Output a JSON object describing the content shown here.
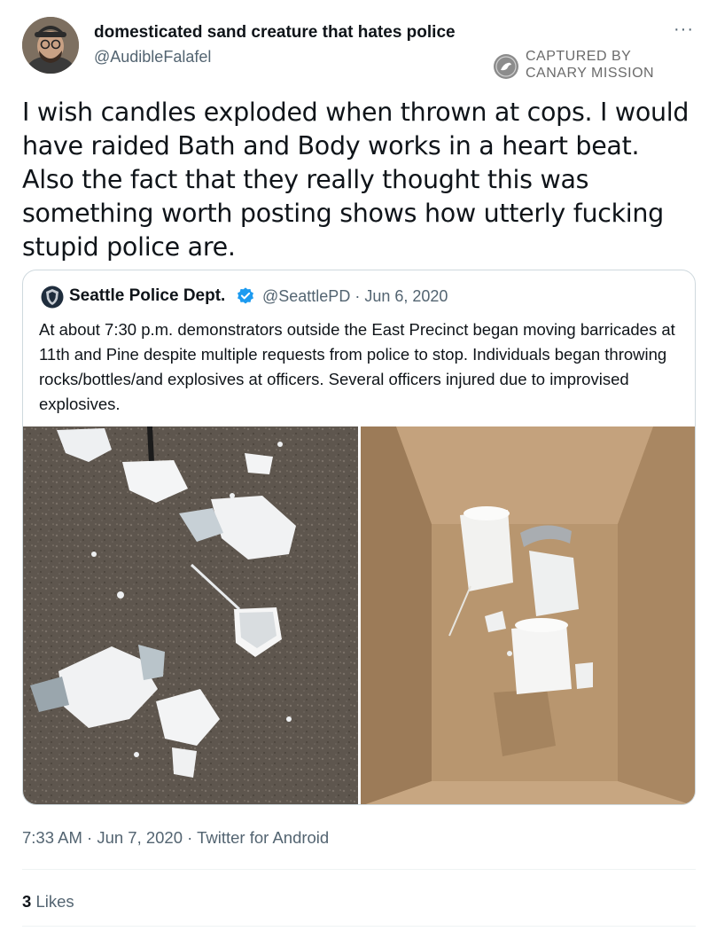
{
  "tweet": {
    "author_name": "domesticated sand creature that hates police",
    "author_handle": "@AudibleFalafel",
    "more_label": "···",
    "text": "I wish candles exploded when thrown at cops. I would have raided Bath and Body works in a heart beat. Also the fact that they really thought this was something worth posting shows how utterly fucking stupid police are.",
    "timestamp": "7:33 AM · Jun 7, 2020 · Twitter for Android",
    "likes_count": "3",
    "likes_label": "Likes"
  },
  "watermark": {
    "line1": "CAPTURED BY",
    "line2": "CANARY MISSION"
  },
  "quoted_tweet": {
    "author_name": "Seattle Police Dept.",
    "author_handle": "@SeattlePD",
    "separator": "·",
    "date": "Jun 6, 2020",
    "text": "At about 7:30 p.m. demonstrators outside the East Precinct began moving barricades at 11th and Pine despite multiple requests from police to stop. Individuals began throwing rocks/bottles/and explosives at officers. Several officers injured due to improvised explosives."
  },
  "colors": {
    "text_primary": "#0f1419",
    "text_secondary": "#536471",
    "border": "#cfd9de",
    "verified_blue": "#1d9bf0"
  },
  "icons": {
    "more": "more-horizontal-icon",
    "verified": "verified-badge-icon",
    "watermark": "canary-logo-icon",
    "quote_logo": "police-badge-icon"
  }
}
